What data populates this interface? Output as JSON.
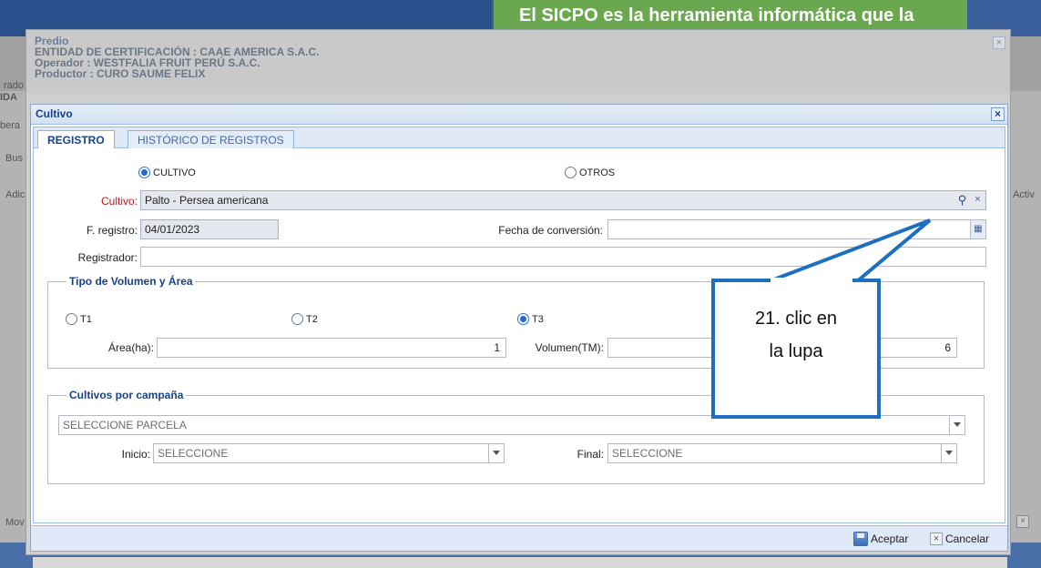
{
  "background": {
    "banner_text": "El SICPO es la herramienta informática que la",
    "left_labels": [
      "rado",
      "IDA",
      "bera",
      "Bus",
      "Adic",
      "Mov"
    ],
    "right_labels": [
      "Activ"
    ]
  },
  "predio": {
    "title": "Predio",
    "entidad": "ENTIDAD DE CERTIFICACIÓN : CAAE AMERICA S.A.C.",
    "operador": "Operador : WESTFALIA FRUIT PERÚ S.A.C.",
    "productor": "Productor : CURO SAUME FELIX",
    "close_icon": "close-icon"
  },
  "cultivo_window": {
    "title": "Cultivo",
    "tabs": [
      {
        "label": "REGISTRO",
        "active": true
      },
      {
        "label": "HISTÓRICO DE REGISTROS",
        "active": false
      }
    ]
  },
  "form": {
    "type_options": [
      {
        "label": "CULTIVO",
        "selected": true
      },
      {
        "label": "OTROS",
        "selected": false
      }
    ],
    "cultivo_label": "Cultivo:",
    "cultivo_value": "Palto - Persea americana",
    "f_registro_label": "F. registro:",
    "f_registro_value": "04/01/2023",
    "fecha_conversion_label": "Fecha de conversión:",
    "fecha_conversion_value": "",
    "registrador_label": "Registrador:",
    "registrador_value": ""
  },
  "volumen_area": {
    "legend": "Tipo de Volumen y Área",
    "options": [
      {
        "label": "T1",
        "selected": false
      },
      {
        "label": "T2",
        "selected": false
      },
      {
        "label": "T3",
        "selected": true
      }
    ],
    "area_label": "Área(ha):",
    "area_value": "1",
    "volumen_label": "Volumen(TM):",
    "volumen_value": "6"
  },
  "campania": {
    "legend": "Cultivos por campaña",
    "parcela_value": "SELECCIONE PARCELA",
    "inicio_label": "Inicio:",
    "inicio_value": "SELECCIONE",
    "final_label": "Final:",
    "final_value": "SELECCIONE"
  },
  "footer": {
    "accept_label": "Aceptar",
    "cancel_label": "Cancelar"
  },
  "callout": {
    "line1": "21. clic en",
    "line2": "la lupa",
    "color": "#1f6fc0"
  }
}
